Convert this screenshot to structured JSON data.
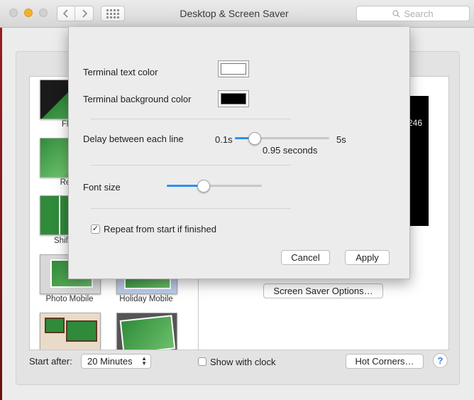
{
  "window": {
    "title": "Desktop & Screen Saver",
    "search_placeholder": "Search"
  },
  "savers": [
    {
      "label": "Floa"
    },
    {
      "label": "Refle"
    },
    {
      "label": "Shiftin"
    },
    {
      "label": "Photo Mobile"
    },
    {
      "label": "Holiday Mobile"
    }
  ],
  "preview": {
    "partial_text": "246"
  },
  "screen_saver_options_label": "Screen Saver Options…",
  "bottom": {
    "start_after_label": "Start after:",
    "start_after_value": "20 Minutes",
    "show_clock_label": "Show with clock",
    "hot_corners_label": "Hot Corners…",
    "help_label": "?"
  },
  "sheet": {
    "text_color_label": "Terminal text color",
    "text_color_value": "#ffffff",
    "bg_color_label": "Terminal background color",
    "bg_color_value": "#000000",
    "delay_label": "Delay between each line",
    "delay_min": "0.1s",
    "delay_max": "5s",
    "delay_value_text": "0.95 seconds",
    "delay_fraction": 0.2,
    "font_size_label": "Font size",
    "font_size_fraction": 0.38,
    "repeat_label": "Repeat from start if finished",
    "repeat_checked": true,
    "check_glyph": "✓",
    "cancel_label": "Cancel",
    "apply_label": "Apply"
  },
  "colors": {
    "accent": "#2f8ef3",
    "minimize_button": "#f5b12e"
  }
}
